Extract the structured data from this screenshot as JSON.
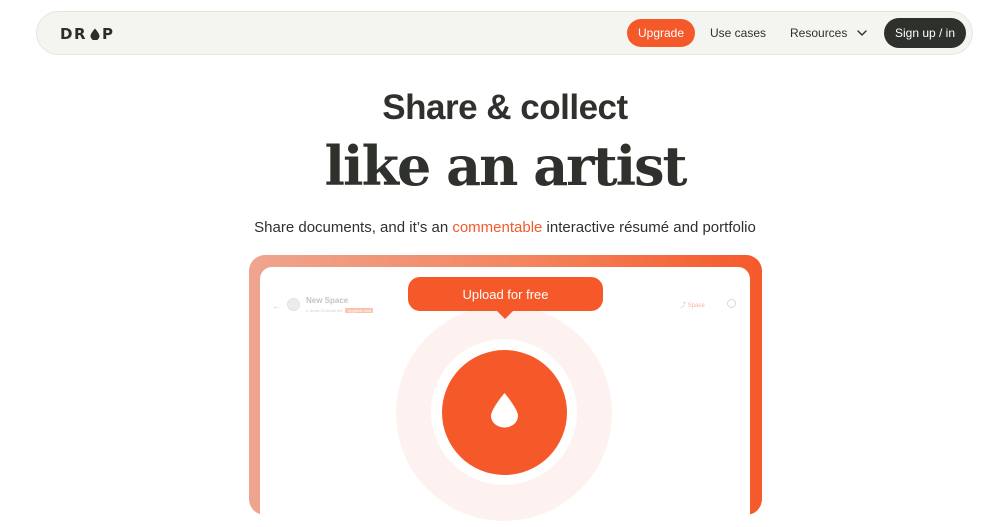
{
  "nav": {
    "logo_prefix": "DR",
    "logo_suffix": "P",
    "logo_icon": "drop-icon",
    "upgrade_label": "Upgrade",
    "use_cases_label": "Use cases",
    "resources_label": "Resources",
    "resources_icon": "chevron-down-icon",
    "signup_label": "Sign up / in"
  },
  "hero": {
    "title_line1": "Share & collect",
    "title_line2": "like an artist",
    "subtitle_before": "Share documents, and it’s an ",
    "subtitle_accent": "commentable",
    "subtitle_after": " interactive résumé and portfolio"
  },
  "preview": {
    "back_icon": "back-arrow-icon",
    "space_title": "New Space",
    "space_meta": "0 views  23 hours left",
    "space_tag": "Upgrade now",
    "share_label": "Space",
    "share_icon": "share-icon",
    "settings_icon": "settings-icon",
    "upload_label": "Upload for free",
    "upload_icon": "drop-icon"
  },
  "colors": {
    "accent": "#f5592a",
    "dark": "#2d302b",
    "nav_bg": "#f4f4f1"
  }
}
